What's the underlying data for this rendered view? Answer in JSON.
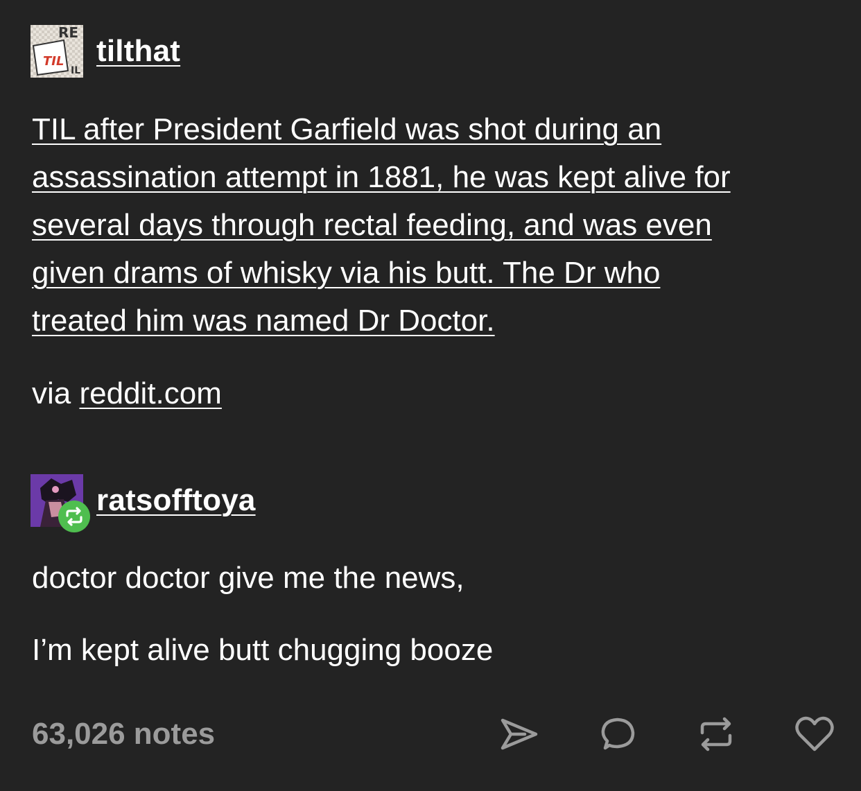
{
  "post": {
    "author": "tilthat",
    "avatar_text": "RE TIL",
    "body_lines": [
      "TIL after President Garfield was shot during an",
      "assassination attempt in 1881, he was kept alive for",
      "several days through rectal feeding, and was even",
      "given drams of whisky via his butt. The Dr who",
      "treated him was named Dr Doctor."
    ],
    "via_prefix": "via ",
    "via_link": "reddit.com"
  },
  "reblog": {
    "author": "ratsofftoya",
    "lines": [
      "doctor doctor give me the news,",
      "I’m kept alive butt chugging booze"
    ]
  },
  "footer": {
    "notes": "63,026 notes",
    "icons": [
      "share-icon",
      "comment-icon",
      "reblog-icon",
      "like-icon"
    ]
  },
  "colors": {
    "background": "#232323",
    "text": "#ffffff",
    "muted": "#9b9b9b",
    "reblog_badge": "#4fbe4f"
  }
}
